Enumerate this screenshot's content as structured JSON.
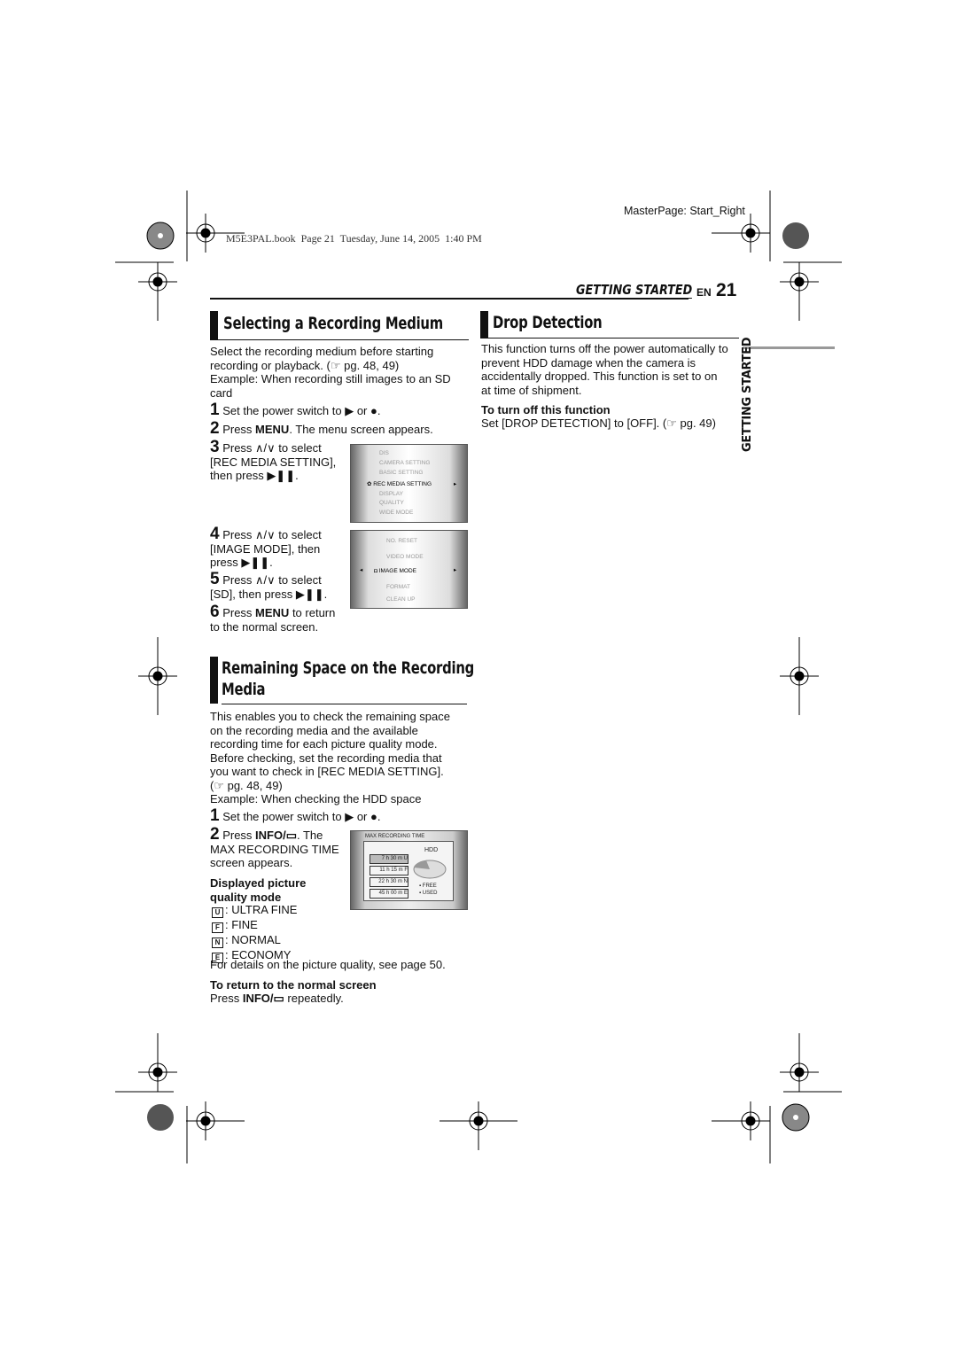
{
  "header": {
    "masterpage": "MasterPage: Start_Right",
    "book_info": "M5E3PAL.book  Page 21  Tuesday, June 14, 2005  1:40 PM",
    "section": "GETTING STARTED",
    "lang": "EN",
    "page_number": "21",
    "side_tab": "GETTING STARTED"
  },
  "selecting": {
    "title": "Selecting a Recording Medium",
    "intro": [
      "Select the recording medium before starting",
      "recording or playback. (☞ pg. 48, 49)",
      "Example: When recording still images to an SD",
      "card"
    ],
    "steps": [
      {
        "n": "1",
        "text": "Set the power switch to ▶ or ●."
      },
      {
        "n": "2",
        "pre": "Press ",
        "bold": "MENU",
        "post": ". The menu screen appears."
      },
      {
        "n": "3",
        "lines": [
          "Press ∧/∨ to select",
          "[REC MEDIA SETTING],",
          "then press ▶❚❚."
        ]
      },
      {
        "n": "4",
        "lines": [
          "Press ∧/∨ to select",
          "[IMAGE MODE], then",
          "press ▶❚❚."
        ]
      },
      {
        "n": "5",
        "lines": [
          "Press ∧/∨ to select",
          "[SD], then press ▶❚❚."
        ]
      },
      {
        "n": "6",
        "pre": "Press ",
        "bold": "MENU",
        "post": " to return",
        "line2": "to the normal screen."
      }
    ],
    "menu1": [
      "DIS",
      "CAMERA SETTING",
      "BASIC SETTING",
      "REC MEDIA SETTING",
      "DISPLAY",
      "QUALITY",
      "WIDE MODE"
    ],
    "menu2": [
      "NO. RESET",
      "VIDEO MODE",
      "IMAGE MODE",
      "FORMAT",
      "CLEAN UP"
    ]
  },
  "drop": {
    "title": "Drop Detection",
    "body": [
      "This function turns off the power automatically to",
      "prevent HDD damage when the camera is",
      "accidentally dropped. This function is set to on",
      "at time of shipment."
    ],
    "sub": "To turn off this function",
    "instr": "Set [DROP DETECTION] to [OFF]. (☞ pg. 49)"
  },
  "remaining": {
    "title": [
      "Remaining Space on the Recording",
      "Media"
    ],
    "body": [
      "This enables you to check the remaining space",
      "on the recording media and the available",
      "recording time for each picture quality mode.",
      "Before checking, set the recording media that",
      "you want to check in [REC MEDIA SETTING].",
      "(☞ pg. 48, 49)",
      "Example: When checking the HDD space"
    ],
    "step1": "Set the power switch to ▶ or ●.",
    "step2": {
      "pre": "Press ",
      "bold": "INFO/▭",
      "post": ". The",
      "l2": "MAX RECORDING TIME",
      "l3": "screen appears."
    },
    "quality_title": [
      "Displayed picture",
      "quality mode"
    ],
    "modes": [
      {
        "k": "U",
        "v": ": ULTRA FINE"
      },
      {
        "k": "F",
        "v": ": FINE"
      },
      {
        "k": "N",
        "v": ": NORMAL"
      },
      {
        "k": "E",
        "v": ": ECONOMY"
      }
    ],
    "details": "For details on the picture quality, see page 50.",
    "return_title": "To return to the normal screen",
    "return_pre": "Press ",
    "return_bold": "INFO/▭",
    "return_post": " repeatedly.",
    "screen": {
      "title": "MAX RECORDING TIME",
      "media": "HDD",
      "times": [
        {
          "t": "7 h 30 m",
          "k": "U"
        },
        {
          "t": "11 h 15 m",
          "k": "F"
        },
        {
          "t": "22 h 30 m",
          "k": "N"
        },
        {
          "t": "45 h 00 m",
          "k": "E"
        }
      ],
      "free": "FREE",
      "used": "USED"
    }
  }
}
